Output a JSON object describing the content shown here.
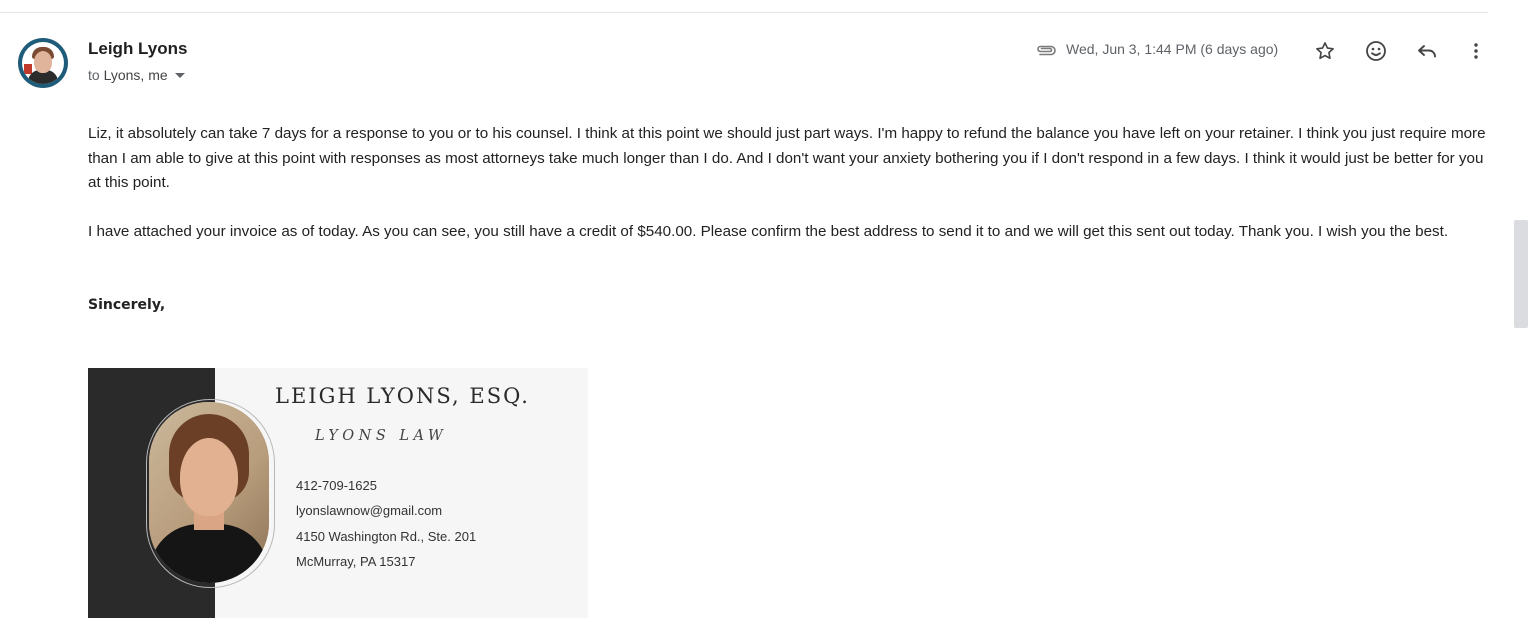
{
  "email": {
    "sender_name": "Leigh Lyons",
    "recipients_prefix": "to",
    "recipients": "Lyons, me",
    "date": "Wed, Jun 3, 1:44 PM (6 days ago)",
    "actions": {
      "star_icon": "star-icon",
      "emoji_icon": "emoji-reaction-icon",
      "reply_icon": "reply-icon",
      "more_icon": "more-vert-icon",
      "attachment_icon": "paperclip-icon"
    },
    "body": {
      "paragraph_1": "Liz,  it absolutely can take 7 days for a response to you or to his counsel.  I think at this point we should just part ways. I'm happy to refund the balance you have left on your retainer. I think you just require more than I am able to give at this point with responses as most attorneys take much longer than I do. And I don't want your anxiety bothering you if I don't respond in a few days. I think it would just be better for you at this point.",
      "paragraph_2": "I have attached your invoice as of today. As you can see, you still have a credit of $540.00. Please confirm the best address to send it to and we will get this sent out today.  Thank you. I wish you the best.",
      "closing": "Sincerely,"
    },
    "signature_card": {
      "name": "LEIGH LYONS, ESQ.",
      "firm": "LYONS LAW",
      "phone": "412-709-1625",
      "email": "lyonslawnow@gmail.com",
      "address_line_1": "4150 Washington Rd., Ste. 201",
      "address_line_2": "McMurray, PA 15317"
    }
  },
  "colors": {
    "avatar_ring": "#1f5c7a",
    "text_primary": "#202124",
    "text_secondary": "#5f6368",
    "card_dark_panel": "#2a2a2a",
    "card_background": "#f6f6f6"
  }
}
